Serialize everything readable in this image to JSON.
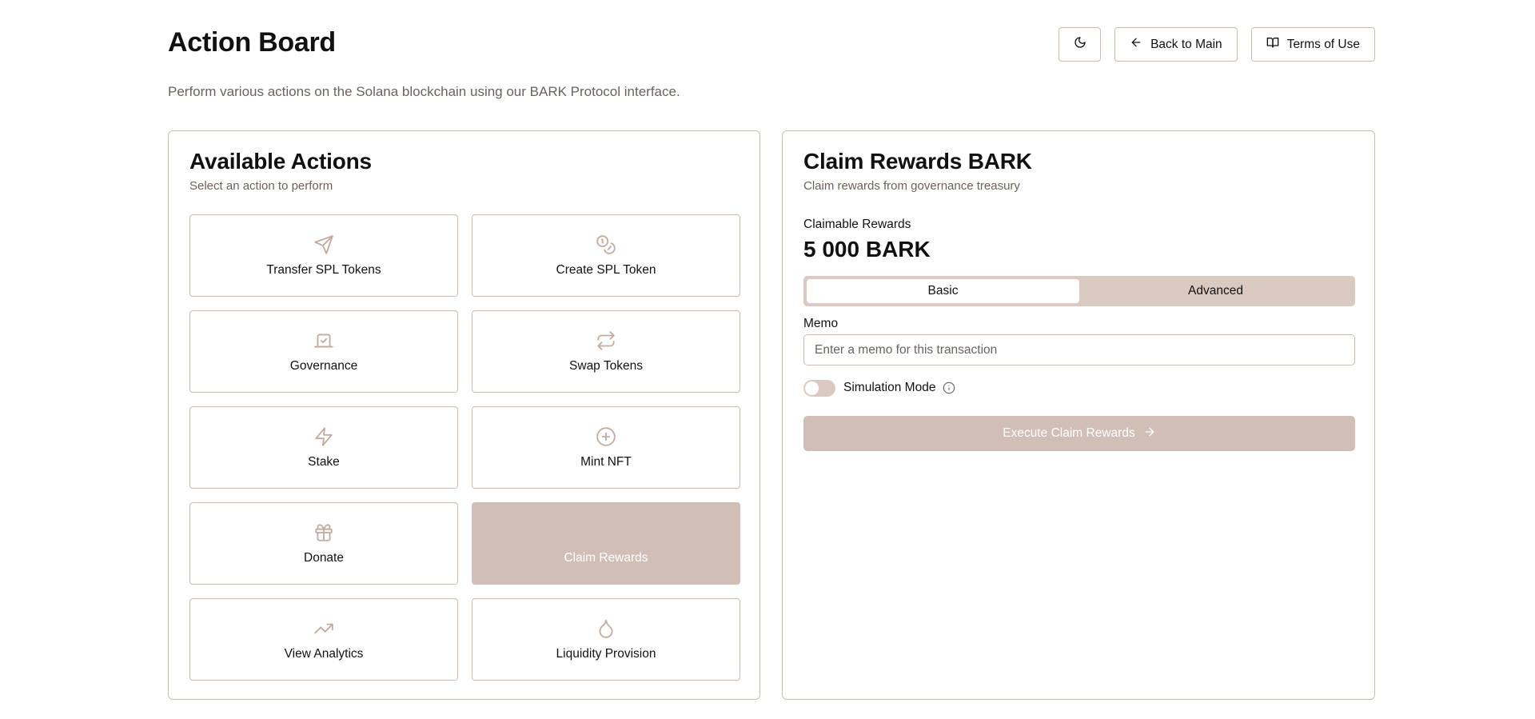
{
  "header": {
    "title": "Action Board",
    "description": "Perform various actions on the Solana blockchain using our BARK Protocol interface.",
    "buttons": {
      "theme_icon": "moon-icon",
      "back_label": "Back to Main",
      "terms_label": "Terms of Use"
    }
  },
  "actions_panel": {
    "title": "Available Actions",
    "subtitle": "Select an action to perform",
    "items": [
      {
        "label": "Transfer SPL Tokens",
        "icon": "send-icon",
        "selected": false
      },
      {
        "label": "Create SPL Token",
        "icon": "coins-icon",
        "selected": false
      },
      {
        "label": "Governance",
        "icon": "vote-icon",
        "selected": false
      },
      {
        "label": "Swap Tokens",
        "icon": "swap-icon",
        "selected": false
      },
      {
        "label": "Stake",
        "icon": "zap-icon",
        "selected": false
      },
      {
        "label": "Mint NFT",
        "icon": "plus-circle-icon",
        "selected": false
      },
      {
        "label": "Donate",
        "icon": "gift-icon",
        "selected": false
      },
      {
        "label": "Claim Rewards",
        "icon": "award-icon",
        "selected": true
      },
      {
        "label": "View Analytics",
        "icon": "trending-up-icon",
        "selected": false
      },
      {
        "label": "Liquidity Provision",
        "icon": "droplet-icon",
        "selected": false
      }
    ]
  },
  "claim_panel": {
    "title": "Claim Rewards BARK",
    "subtitle": "Claim rewards from governance treasury",
    "claimable_label": "Claimable Rewards",
    "claimable_amount": "5 000 BARK",
    "tabs": [
      {
        "label": "Basic",
        "active": true
      },
      {
        "label": "Advanced",
        "active": false
      }
    ],
    "memo_label": "Memo",
    "memo_placeholder": "Enter a memo for this transaction",
    "memo_value": "",
    "simulation_label": "Simulation Mode",
    "simulation_on": false,
    "execute_label": "Execute Claim Rewards"
  },
  "colors": {
    "accent": "#d1bfb7",
    "border": "#cbbcb4",
    "muted_text": "#6b625d",
    "icon_tint": "#c2aca2"
  }
}
